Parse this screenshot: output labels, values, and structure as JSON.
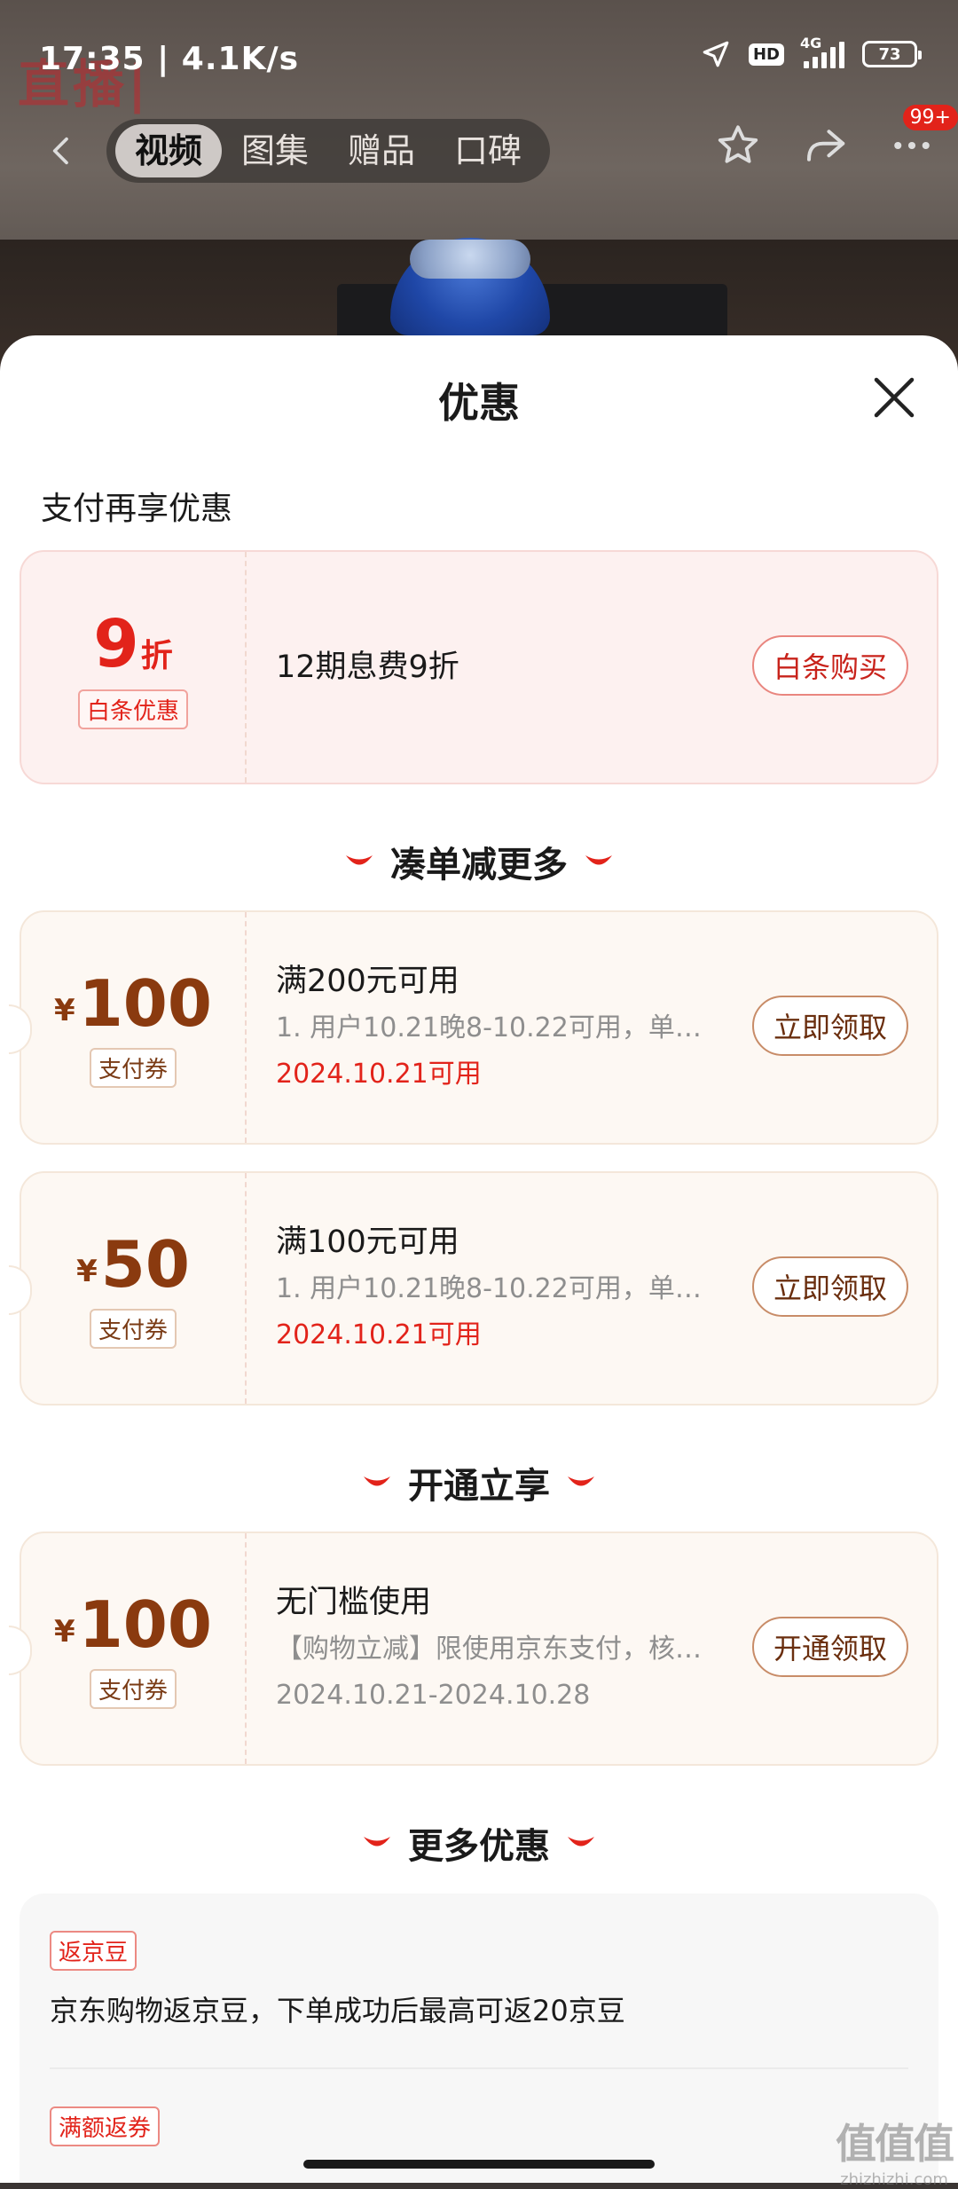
{
  "status_bar": {
    "time": "17:35 | 4.1K/s",
    "hd": "HD",
    "network": "4G",
    "battery": "73"
  },
  "background": {
    "logo_text": "直播|"
  },
  "nav": {
    "tabs": [
      {
        "label": "视频",
        "active": true
      },
      {
        "label": "图集",
        "active": false
      },
      {
        "label": "赠品",
        "active": false
      },
      {
        "label": "口碑",
        "active": false
      }
    ],
    "badge": "99+"
  },
  "sheet": {
    "title": "优惠",
    "section_pay": "支付再享优惠",
    "baitiao": {
      "discount_number": "9",
      "discount_unit": "折",
      "tag": "白条优惠",
      "desc": "12期息费9折",
      "action": "白条购买"
    },
    "section_combo": "凑单减更多",
    "coupons": [
      {
        "yen": "¥",
        "amount": "100",
        "tag": "支付券",
        "title": "满200元可用",
        "desc": "1. 用户10.21晚8-10.22可用，单…",
        "date": "2024.10.21可用",
        "action": "立即领取"
      },
      {
        "yen": "¥",
        "amount": "50",
        "tag": "支付券",
        "title": "满100元可用",
        "desc": "1. 用户10.21晚8-10.22可用，单…",
        "date": "2024.10.21可用",
        "action": "立即领取"
      }
    ],
    "section_open": "开通立享",
    "open_coupon": {
      "yen": "¥",
      "amount": "100",
      "tag": "支付券",
      "title": "无门槛使用",
      "desc": "【购物立减】限使用京东支付，核…",
      "date": "2024.10.21-2024.10.28",
      "action": "开通领取"
    },
    "section_more": "更多优惠",
    "more_items": [
      {
        "tag": "返京豆",
        "text": "京东购物返京豆，下单成功后最高可返20京豆"
      },
      {
        "tag": "满额返券",
        "text": ""
      }
    ]
  },
  "watermark": {
    "line1": "值值值",
    "line2": "zhizhizhi.com"
  }
}
